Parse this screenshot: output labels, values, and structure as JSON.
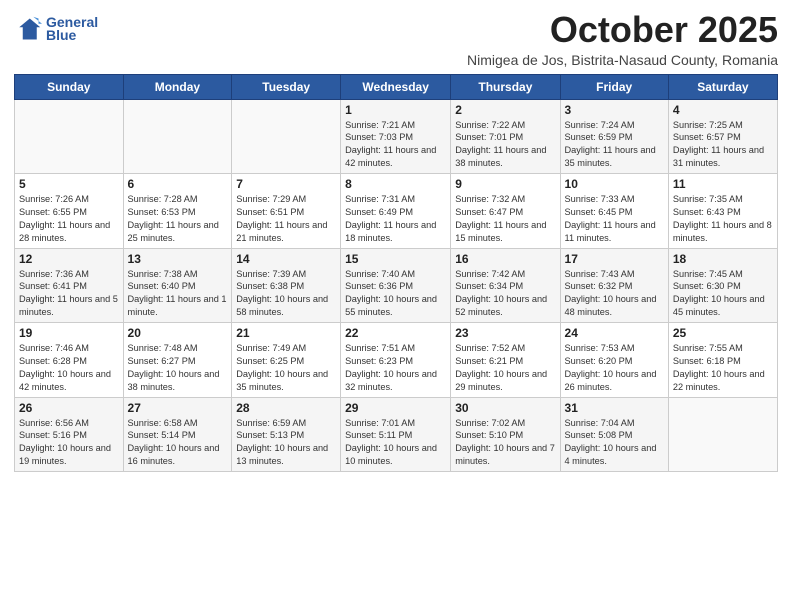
{
  "header": {
    "logo_line1": "General",
    "logo_line2": "Blue",
    "title": "October 2025",
    "subtitle": "Nimigea de Jos, Bistrita-Nasaud County, Romania"
  },
  "days_of_week": [
    "Sunday",
    "Monday",
    "Tuesday",
    "Wednesday",
    "Thursday",
    "Friday",
    "Saturday"
  ],
  "weeks": [
    [
      {
        "day": "",
        "info": ""
      },
      {
        "day": "",
        "info": ""
      },
      {
        "day": "",
        "info": ""
      },
      {
        "day": "1",
        "info": "Sunrise: 7:21 AM\nSunset: 7:03 PM\nDaylight: 11 hours and 42 minutes."
      },
      {
        "day": "2",
        "info": "Sunrise: 7:22 AM\nSunset: 7:01 PM\nDaylight: 11 hours and 38 minutes."
      },
      {
        "day": "3",
        "info": "Sunrise: 7:24 AM\nSunset: 6:59 PM\nDaylight: 11 hours and 35 minutes."
      },
      {
        "day": "4",
        "info": "Sunrise: 7:25 AM\nSunset: 6:57 PM\nDaylight: 11 hours and 31 minutes."
      }
    ],
    [
      {
        "day": "5",
        "info": "Sunrise: 7:26 AM\nSunset: 6:55 PM\nDaylight: 11 hours and 28 minutes."
      },
      {
        "day": "6",
        "info": "Sunrise: 7:28 AM\nSunset: 6:53 PM\nDaylight: 11 hours and 25 minutes."
      },
      {
        "day": "7",
        "info": "Sunrise: 7:29 AM\nSunset: 6:51 PM\nDaylight: 11 hours and 21 minutes."
      },
      {
        "day": "8",
        "info": "Sunrise: 7:31 AM\nSunset: 6:49 PM\nDaylight: 11 hours and 18 minutes."
      },
      {
        "day": "9",
        "info": "Sunrise: 7:32 AM\nSunset: 6:47 PM\nDaylight: 11 hours and 15 minutes."
      },
      {
        "day": "10",
        "info": "Sunrise: 7:33 AM\nSunset: 6:45 PM\nDaylight: 11 hours and 11 minutes."
      },
      {
        "day": "11",
        "info": "Sunrise: 7:35 AM\nSunset: 6:43 PM\nDaylight: 11 hours and 8 minutes."
      }
    ],
    [
      {
        "day": "12",
        "info": "Sunrise: 7:36 AM\nSunset: 6:41 PM\nDaylight: 11 hours and 5 minutes."
      },
      {
        "day": "13",
        "info": "Sunrise: 7:38 AM\nSunset: 6:40 PM\nDaylight: 11 hours and 1 minute."
      },
      {
        "day": "14",
        "info": "Sunrise: 7:39 AM\nSunset: 6:38 PM\nDaylight: 10 hours and 58 minutes."
      },
      {
        "day": "15",
        "info": "Sunrise: 7:40 AM\nSunset: 6:36 PM\nDaylight: 10 hours and 55 minutes."
      },
      {
        "day": "16",
        "info": "Sunrise: 7:42 AM\nSunset: 6:34 PM\nDaylight: 10 hours and 52 minutes."
      },
      {
        "day": "17",
        "info": "Sunrise: 7:43 AM\nSunset: 6:32 PM\nDaylight: 10 hours and 48 minutes."
      },
      {
        "day": "18",
        "info": "Sunrise: 7:45 AM\nSunset: 6:30 PM\nDaylight: 10 hours and 45 minutes."
      }
    ],
    [
      {
        "day": "19",
        "info": "Sunrise: 7:46 AM\nSunset: 6:28 PM\nDaylight: 10 hours and 42 minutes."
      },
      {
        "day": "20",
        "info": "Sunrise: 7:48 AM\nSunset: 6:27 PM\nDaylight: 10 hours and 38 minutes."
      },
      {
        "day": "21",
        "info": "Sunrise: 7:49 AM\nSunset: 6:25 PM\nDaylight: 10 hours and 35 minutes."
      },
      {
        "day": "22",
        "info": "Sunrise: 7:51 AM\nSunset: 6:23 PM\nDaylight: 10 hours and 32 minutes."
      },
      {
        "day": "23",
        "info": "Sunrise: 7:52 AM\nSunset: 6:21 PM\nDaylight: 10 hours and 29 minutes."
      },
      {
        "day": "24",
        "info": "Sunrise: 7:53 AM\nSunset: 6:20 PM\nDaylight: 10 hours and 26 minutes."
      },
      {
        "day": "25",
        "info": "Sunrise: 7:55 AM\nSunset: 6:18 PM\nDaylight: 10 hours and 22 minutes."
      }
    ],
    [
      {
        "day": "26",
        "info": "Sunrise: 6:56 AM\nSunset: 5:16 PM\nDaylight: 10 hours and 19 minutes."
      },
      {
        "day": "27",
        "info": "Sunrise: 6:58 AM\nSunset: 5:14 PM\nDaylight: 10 hours and 16 minutes."
      },
      {
        "day": "28",
        "info": "Sunrise: 6:59 AM\nSunset: 5:13 PM\nDaylight: 10 hours and 13 minutes."
      },
      {
        "day": "29",
        "info": "Sunrise: 7:01 AM\nSunset: 5:11 PM\nDaylight: 10 hours and 10 minutes."
      },
      {
        "day": "30",
        "info": "Sunrise: 7:02 AM\nSunset: 5:10 PM\nDaylight: 10 hours and 7 minutes."
      },
      {
        "day": "31",
        "info": "Sunrise: 7:04 AM\nSunset: 5:08 PM\nDaylight: 10 hours and 4 minutes."
      },
      {
        "day": "",
        "info": ""
      }
    ]
  ]
}
